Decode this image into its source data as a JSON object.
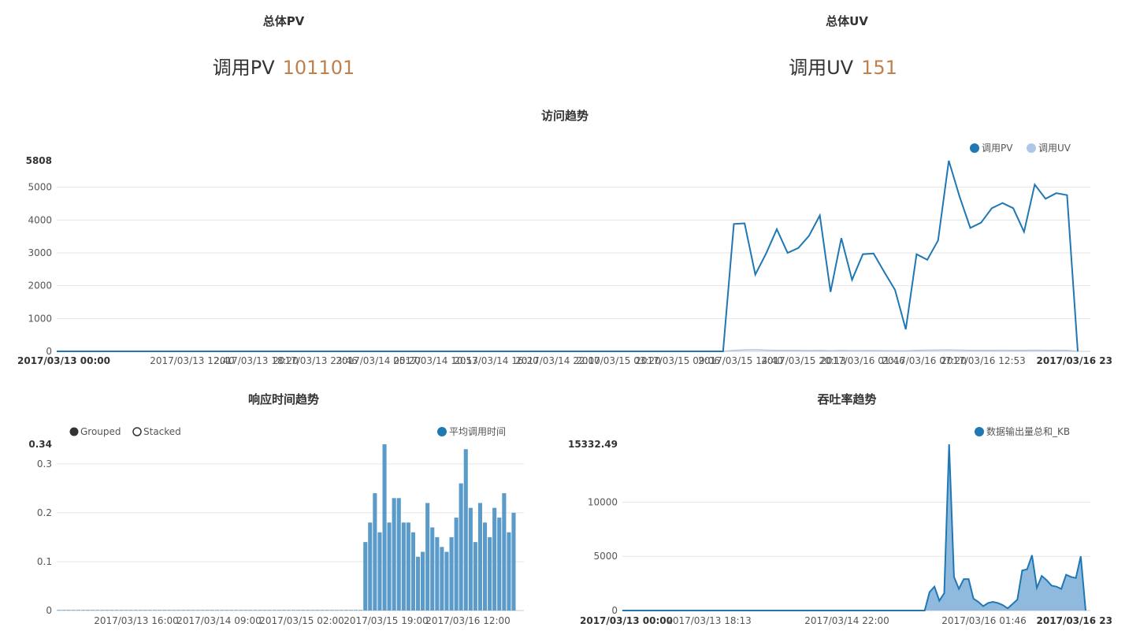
{
  "pv_panel": {
    "title": "总体PV",
    "label": "调用PV",
    "value": "101101"
  },
  "uv_panel": {
    "title": "总体UV",
    "label": "调用UV",
    "value": "151"
  },
  "colors": {
    "pv": "#1f77b4",
    "uv": "#aec7e8",
    "bar": "#5a9bc9",
    "area_fill": "#8fbadd",
    "stat_number": "#c0804b",
    "grid": "#e5e5e5"
  },
  "chart_data": [
    {
      "type": "line",
      "title": "访问趋势",
      "legend": [
        "调用PV",
        "调用UV"
      ],
      "legend_position": "top-right",
      "y_ticks": [
        0,
        1000,
        2000,
        3000,
        4000,
        5000
      ],
      "y_max_label": "5808",
      "ylim": [
        0,
        5808
      ],
      "x_ticks": [
        "2017/03/13 12:40",
        "2017/03/13 18:20",
        "2017/03/13 23:46",
        "2017/03/14 05:20",
        "2017/03/14 10:53",
        "2017/03/14 16:20",
        "2017/03/14 22:00",
        "2017/03/15 03:20",
        "2017/03/15 09:06",
        "2017/03/15 14:40",
        "2017/03/15 20:13",
        "2017/03/16 01:46",
        "2017/03/16 07:20",
        "2017/03/16 12:53"
      ],
      "x_start_label": "2017/03/13 00:00",
      "x_end_label": "2017/03/16 23",
      "grid": true,
      "series": [
        {
          "name": "调用PV",
          "zero_points": 62,
          "values": [
            0,
            3880,
            3900,
            2340,
            2980,
            3720,
            3000,
            3150,
            3520,
            4140,
            1810,
            3450,
            2180,
            2960,
            2980,
            2420,
            1870,
            670,
            2960,
            2790,
            3380,
            5808,
            4720,
            3760,
            3920,
            4360,
            4520,
            4360,
            3640,
            5080,
            4650,
            4820,
            4760,
            0
          ]
        },
        {
          "name": "调用UV",
          "zero_points": 62,
          "values": [
            0,
            30,
            40,
            50,
            35,
            30,
            28,
            30,
            25,
            30,
            20,
            28,
            22,
            25,
            25,
            22,
            20,
            15,
            30,
            35,
            38,
            40,
            35,
            30,
            30,
            32,
            33,
            30,
            28,
            35,
            32,
            33,
            32,
            0
          ]
        }
      ]
    },
    {
      "type": "bar",
      "title": "响应时间趋势",
      "controls": [
        "Grouped",
        "Stacked"
      ],
      "legend": [
        "平均调用时间"
      ],
      "legend_position": "top-right",
      "y_ticks": [
        0,
        0.1,
        0.2,
        0.3
      ],
      "y_max_label": "0.34",
      "ylim": [
        0,
        0.34
      ],
      "x_ticks": [
        "2017/03/13 16:00",
        "2017/03/14 09:00",
        "2017/03/15 02:00",
        "2017/03/15 19:00",
        "2017/03/16 12:00"
      ],
      "grid": true,
      "series": [
        {
          "name": "平均调用时间",
          "zero_bars": 64,
          "values": [
            0.14,
            0.18,
            0.24,
            0.16,
            0.34,
            0.18,
            0.23,
            0.23,
            0.18,
            0.18,
            0.16,
            0.11,
            0.12,
            0.22,
            0.17,
            0.15,
            0.13,
            0.12,
            0.15,
            0.19,
            0.26,
            0.33,
            0.21,
            0.14,
            0.22,
            0.18,
            0.15,
            0.21,
            0.19,
            0.24,
            0.16,
            0.2
          ]
        }
      ]
    },
    {
      "type": "area",
      "title": "吞吐率趋势",
      "legend": [
        "数据输出量总和_KB"
      ],
      "legend_position": "top-right",
      "y_ticks": [
        0,
        5000,
        10000
      ],
      "y_max_label": "15332.49",
      "ylim": [
        0,
        15332.49
      ],
      "x_ticks": [
        "2017/03/13 18:13",
        "2017/03/14 22:00",
        "2017/03/16 01:46"
      ],
      "x_start_label": "2017/03/13 00:00",
      "x_end_label": "2017/03/16 23",
      "grid": true,
      "series": [
        {
          "name": "数据输出量总和_KB",
          "zero_points": 62,
          "values": [
            0,
            1700,
            2200,
            900,
            1600,
            15332.49,
            3100,
            2000,
            2900,
            2900,
            1100,
            800,
            400,
            700,
            800,
            700,
            500,
            200,
            600,
            1000,
            3700,
            3800,
            5100,
            2100,
            3200,
            2800,
            2300,
            2200,
            2000,
            3300,
            3100,
            3000,
            5000,
            0
          ]
        }
      ]
    }
  ]
}
